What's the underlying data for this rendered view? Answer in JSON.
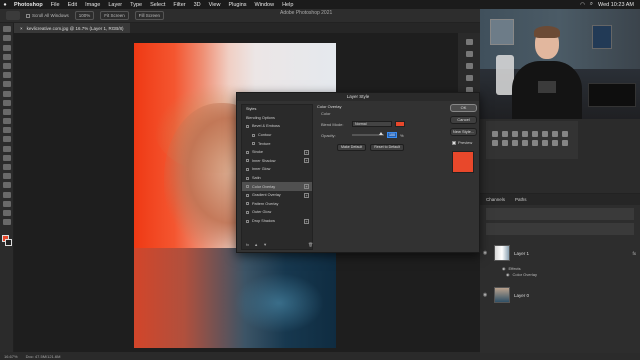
{
  "menubar": {
    "app": "Photoshop",
    "items": [
      "File",
      "Edit",
      "Image",
      "Layer",
      "Type",
      "Select",
      "Filter",
      "3D",
      "View",
      "Plugins",
      "Window",
      "Help"
    ],
    "clock": "Wed 10:23 AM"
  },
  "options_bar": {
    "scroll_all": "Scroll All Windows",
    "zoom_100": "100%",
    "fit_screen": "Fit Screen",
    "fill_screen": "Fill Screen"
  },
  "app_title": "Adobe Photoshop 2021",
  "doc_tab": {
    "title": "kevlicreative.com.jpg @ 16.7% (Layer 1, RGB/8)",
    "close": "×"
  },
  "status_bar": {
    "zoom": "16.67%",
    "doc_info": "Doc: 47.5M/121.6M"
  },
  "layer_style_dialog": {
    "title": "Layer Style",
    "list_header": "Styles",
    "items": [
      {
        "label": "Blending Options",
        "checkbox": false,
        "plus": false,
        "sub": false,
        "active": false
      },
      {
        "label": "Bevel & Emboss",
        "checkbox": true,
        "plus": false,
        "sub": false,
        "active": false
      },
      {
        "label": "Contour",
        "checkbox": true,
        "plus": false,
        "sub": true,
        "active": false
      },
      {
        "label": "Texture",
        "checkbox": true,
        "plus": false,
        "sub": true,
        "active": false
      },
      {
        "label": "Stroke",
        "checkbox": true,
        "plus": true,
        "sub": false,
        "active": false
      },
      {
        "label": "Inner Shadow",
        "checkbox": true,
        "plus": true,
        "sub": false,
        "active": false
      },
      {
        "label": "Inner Glow",
        "checkbox": true,
        "plus": false,
        "sub": false,
        "active": false
      },
      {
        "label": "Satin",
        "checkbox": true,
        "plus": false,
        "sub": false,
        "active": false
      },
      {
        "label": "Color Overlay",
        "checkbox": true,
        "plus": true,
        "sub": false,
        "active": true
      },
      {
        "label": "Gradient Overlay",
        "checkbox": true,
        "plus": true,
        "sub": false,
        "active": false
      },
      {
        "label": "Pattern Overlay",
        "checkbox": true,
        "plus": false,
        "sub": false,
        "active": false
      },
      {
        "label": "Outer Glow",
        "checkbox": true,
        "plus": false,
        "sub": false,
        "active": false
      },
      {
        "label": "Drop Shadow",
        "checkbox": true,
        "plus": true,
        "sub": false,
        "active": false
      }
    ],
    "footer_fx": "fx",
    "footer_up": "▲",
    "footer_down": "▼",
    "footer_trash": "🗑",
    "section": "Color Overlay",
    "subsection": "Color",
    "blend_mode_label": "Blend Mode:",
    "blend_mode_value": "Normal",
    "opacity_label": "Opacity:",
    "opacity_value": "100",
    "opacity_unit": "%",
    "make_default": "Make Default",
    "reset_default": "Reset to Default",
    "ok": "OK",
    "cancel": "Cancel",
    "new_style": "New Style...",
    "preview": "Preview",
    "overlay_color": "#e8482b"
  },
  "layers_panel": {
    "tabs": [
      "Channels",
      "Paths"
    ],
    "layers": [
      {
        "name": "Layer 1",
        "fx": "fx",
        "effects_label": "Effects",
        "effect": "Color Overlay"
      },
      {
        "name": "Layer 0"
      }
    ]
  },
  "colors": {
    "accent": "#e8482b",
    "panel": "#2b2b2b",
    "dialog": "#323232"
  }
}
